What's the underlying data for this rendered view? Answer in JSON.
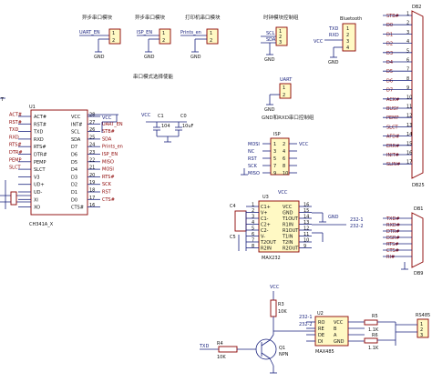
{
  "captions": {
    "async_serial_1": "异步串口模块",
    "async_serial_2": "异步串口模块",
    "printer_serial": "打印机串口模块",
    "clock_module_1": "时钟模块控制组",
    "enable_rs_mode": "串口模式选择使能",
    "rs485_control": "GND和RXD串口控制组"
  },
  "connectors": {
    "uart_en": "UART_EN",
    "isp_en": "ISP_EN",
    "prints_en": "Prints_en",
    "uart_en_right": "UART",
    "isp": "ISP",
    "bluetooth": "Bluetooth",
    "scl": "SCL",
    "sda": "SDA",
    "txd": "TXD",
    "rxd": "RXD",
    "gnd": "GND",
    "vcc": "VCC",
    "mosi": "MOSI",
    "miso": "MISO",
    "sck": "SCK",
    "rst": "RST"
  },
  "u1": {
    "ref": "U1",
    "part": "CH341A_X",
    "left_pins": [
      "ACT#",
      "RST#",
      "TXD",
      "RXD",
      "RTS#",
      "DTR#",
      "PEMP",
      "SLCT",
      "V3",
      "UD+",
      "UD-",
      "XI",
      "XO"
    ],
    "left_nets": [
      "ACT#",
      "RST#",
      "TXD",
      "RXD",
      "RTS#",
      "DTR#",
      "PEMP",
      "SLCT"
    ],
    "right_pins": [
      "VCC",
      "INT#",
      "SCL",
      "SDA",
      "D7",
      "D6",
      "D5",
      "D4",
      "D3",
      "D2",
      "D1",
      "D0",
      "CTS#"
    ],
    "right_nets": [
      "UART_EN",
      "STB#",
      "SDA",
      "Prints_en",
      "ISP_EN",
      "MISO",
      "MOSI",
      "RTS#",
      "SCK",
      "RST",
      "CTS#"
    ],
    "pin_numbers": [
      "28",
      "27",
      "26",
      "25",
      "24",
      "23",
      "22",
      "21",
      "20",
      "19",
      "18",
      "17",
      "16"
    ]
  },
  "caps": {
    "c1": "C1",
    "c1_val": "104",
    "c0": "C0",
    "c0_val": "10uF",
    "c4": "C4",
    "c5": "C5"
  },
  "isp_header": {
    "pins": [
      "MOSI",
      "NC",
      "RST",
      "SCK",
      "MISO"
    ],
    "right": [
      "VCC",
      "GND",
      "GND",
      "GND",
      "GND"
    ],
    "label": "ISP"
  },
  "max232": {
    "ref": "U3",
    "part": "MAX232",
    "left_pins": [
      "C1+",
      "V+",
      "C1-",
      "C2+",
      "C2-",
      "V-",
      "T2OUT",
      "R2IN"
    ],
    "right_pins": [
      "VCC",
      "GND",
      "T1OUT",
      "R1IN",
      "R1OUT",
      "T1IN",
      "T2IN",
      "R2OUT"
    ],
    "left_nums": [
      "1",
      "2",
      "3",
      "4",
      "5",
      "6",
      "7",
      "8"
    ],
    "right_nums": [
      "16",
      "15",
      "14",
      "13",
      "12",
      "11",
      "10",
      "9"
    ],
    "nets_right": [
      "232-1",
      "232-2"
    ]
  },
  "db25": {
    "ref": "DB2",
    "name": "DB25",
    "labels": [
      "STB#",
      "D0",
      "D1",
      "D2",
      "D3",
      "D4",
      "D5",
      "D6",
      "D7",
      "ACK#",
      "BUSY",
      "PEMP",
      "SLCT",
      "AFD#",
      "ERR#",
      "INIT#",
      "SLIN#"
    ]
  },
  "db9": {
    "ref": "DB1",
    "name": "DB9",
    "labels": [
      "TXD#",
      "RXD#",
      "DTR#",
      "DSR#",
      "RTS#",
      "CTS#",
      "RI#"
    ]
  },
  "rs485": {
    "ref": "U2",
    "part": "MAX485",
    "left_pins": [
      "RO",
      "RE",
      "DE",
      "DI"
    ],
    "right_pins": [
      "VCC",
      "B",
      "A",
      "GND"
    ],
    "nets_left": [
      "232-1",
      "232-2"
    ],
    "r3": "R3",
    "r3_val": "10K",
    "r4": "R4",
    "r4_val": "10K",
    "r5": "R5",
    "r5_val": "1.1K",
    "r6": "R6",
    "r6_val": "1.1K",
    "q1": "Q1",
    "q1_part": "NPN",
    "txd": "TXD",
    "header": "RS485",
    "vcc": "VCC",
    "gnd": "GND"
  }
}
